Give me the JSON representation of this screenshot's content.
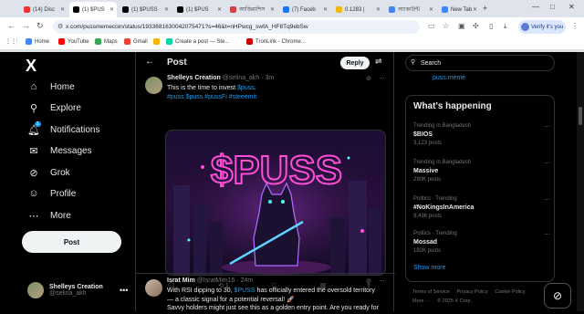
{
  "browser": {
    "tabs": [
      {
        "label": "(14) Disc",
        "color": "#e33"
      },
      {
        "label": "(1) $PUS",
        "color": "#000"
      },
      {
        "label": "(1) $PUSS",
        "color": "#000"
      },
      {
        "label": "(1) $PUS",
        "color": "#000"
      },
      {
        "label": "আজিমাশিস",
        "color": "#c44"
      },
      {
        "label": "(7) Faceb",
        "color": "#1877f2"
      },
      {
        "label": "0.1283 |",
        "color": "#f0b90b"
      },
      {
        "label": "অ্যাকাউন্ট",
        "color": "#4285f4"
      },
      {
        "label": "New Tab",
        "color": "#4285f4"
      }
    ],
    "new_tab_symbol": "+",
    "window_controls": [
      "—",
      "□",
      "✕"
    ],
    "url": "x.com/pussmemecoin/status/1933681630042075471?s=46&t=nHPwcg_swfA_HF8Tq9ebSw",
    "verify_label": "Verify it's you",
    "bookmarks": [
      "Home",
      "YouTube",
      "Maps",
      "Gmail",
      "",
      "Create a post — Ste...",
      "TronLink - Chrome..."
    ]
  },
  "sidebar": {
    "logo": "X",
    "items": [
      {
        "label": "Home",
        "icon": "⌂"
      },
      {
        "label": "Explore",
        "icon": "⚲"
      },
      {
        "label": "Notifications",
        "icon": "🔔︎",
        "badge": "1"
      },
      {
        "label": "Messages",
        "icon": "✉"
      },
      {
        "label": "Grok",
        "icon": "⊘"
      },
      {
        "label": "Profile",
        "icon": "☺"
      },
      {
        "label": "More",
        "icon": "⋯"
      }
    ],
    "post_button": "Post",
    "account": {
      "name": "Shelleys Creation",
      "handle": "@selina_akh",
      "more": "•••"
    }
  },
  "main": {
    "title": "Post",
    "reply_button": "Reply",
    "tweet1": {
      "name": "Shelleys Creation",
      "handle": "@selina_akh · 3m",
      "line1_text": "This is the time to invest ",
      "line1_tag": "$puss",
      "line1_end": ".",
      "line2": "#puss $puss #pussFi #steeemit",
      "image_text": "$PUSS",
      "actions": {
        "reply": "",
        "retweet": "1",
        "like": "",
        "views": ""
      }
    },
    "tweet2": {
      "name": "Israt Mim",
      "handle": "@IsratMim16 · 24m",
      "line1_a": "With RSI dipping to 30, ",
      "line1_tag": "$PUSS",
      "line1_b": " has officially entered the oversold territory",
      "line2": "— a classic signal for a potential reversal! 🚀",
      "line3": "Savvy holders might just see this as a golden entry point. Are you ready for"
    }
  },
  "right": {
    "search_placeholder": "Search",
    "premium_link": "puss.meme",
    "trends_title": "What's happening",
    "trends": [
      {
        "category": "Trending in Bangladesh",
        "name": "$BIOS",
        "count": "3,123 posts"
      },
      {
        "category": "Trending in Bangladesh",
        "name": "Massive",
        "count": "290K posts"
      },
      {
        "category": "Politics · Trending",
        "name": "#NoKingsInAmerica",
        "count": "9,436 posts"
      },
      {
        "category": "Politics · Trending",
        "name": "Mossad",
        "count": "182K posts"
      }
    ],
    "show_more": "Show more",
    "footer": [
      "Terms of Service",
      "Privacy Policy",
      "Cookie Policy",
      "More ···",
      "© 2025 X Corp."
    ]
  }
}
